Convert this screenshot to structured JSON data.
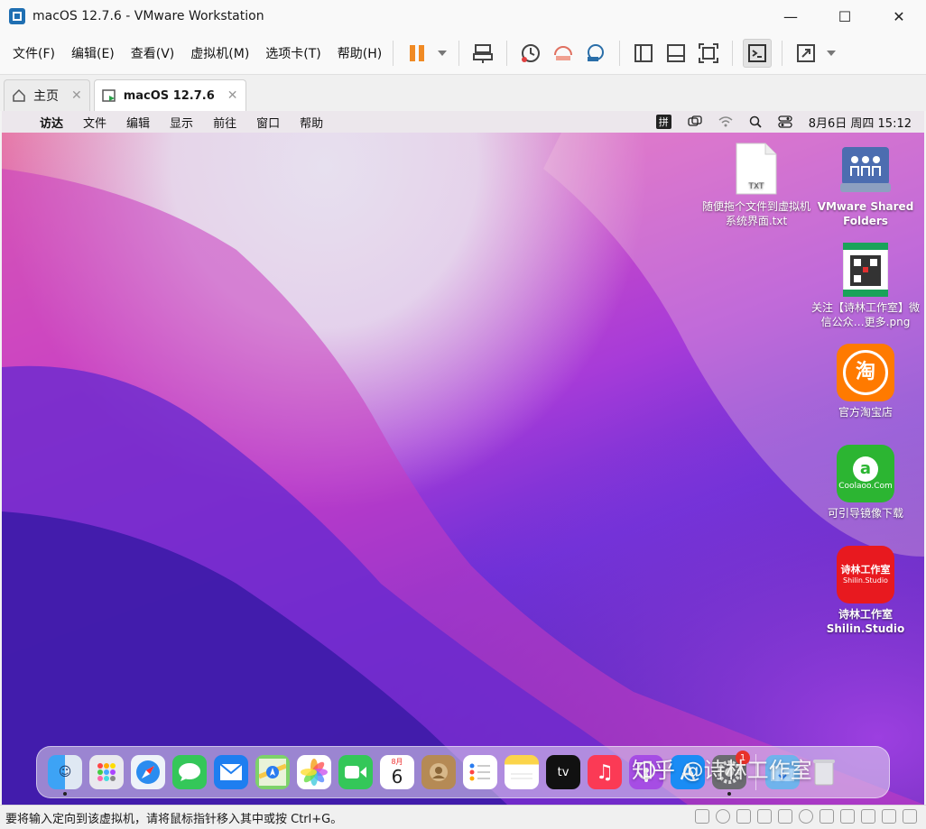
{
  "window": {
    "title": "macOS 12.7.6 - VMware Workstation",
    "minimize": "—",
    "maximize": "☐",
    "close": "✕"
  },
  "menu": [
    "文件(F)",
    "编辑(E)",
    "查看(V)",
    "虚拟机(M)",
    "选项卡(T)",
    "帮助(H)"
  ],
  "tabs": {
    "home": "主页",
    "vm": "macOS 12.7.6",
    "close": "✕"
  },
  "mac_menubar": {
    "apple": "",
    "items": [
      "访达",
      "文件",
      "编辑",
      "显示",
      "前往",
      "窗口",
      "帮助"
    ],
    "input_method": "拼",
    "datetime": "8月6日 周四  15:12"
  },
  "desktop": {
    "txt_file": {
      "badge": "TXT",
      "label": "随便拖个文件到虚拟机系统界面.txt"
    },
    "shared": {
      "label": "VMware Shared Folders"
    },
    "qr": {
      "label": "关注【诗林工作室】微信公众…更多.png"
    },
    "taobao": {
      "glyph": "淘",
      "label": "官方淘宝店"
    },
    "coolaoo": {
      "glyph": "a",
      "sub": "Coolaoo.Com",
      "label": "可引导镜像下载"
    },
    "shilin": {
      "glyph": "诗林工作室",
      "sub": "Shilin.Studio",
      "label": "诗林工作室 Shilin.Studio"
    }
  },
  "dock": {
    "calendar_month": "8月",
    "calendar_day": "6",
    "tv": "tv",
    "badge": "1"
  },
  "watermark": "知乎 @诗林工作室",
  "status": {
    "text": "要将输入定向到该虚拟机，请将鼠标指针移入其中或按 Ctrl+G。"
  },
  "colors": {
    "accent_pause": "#f08a24",
    "wallpaper_magenta": "#d04fc4",
    "wallpaper_indigo": "#3b1ea8"
  }
}
